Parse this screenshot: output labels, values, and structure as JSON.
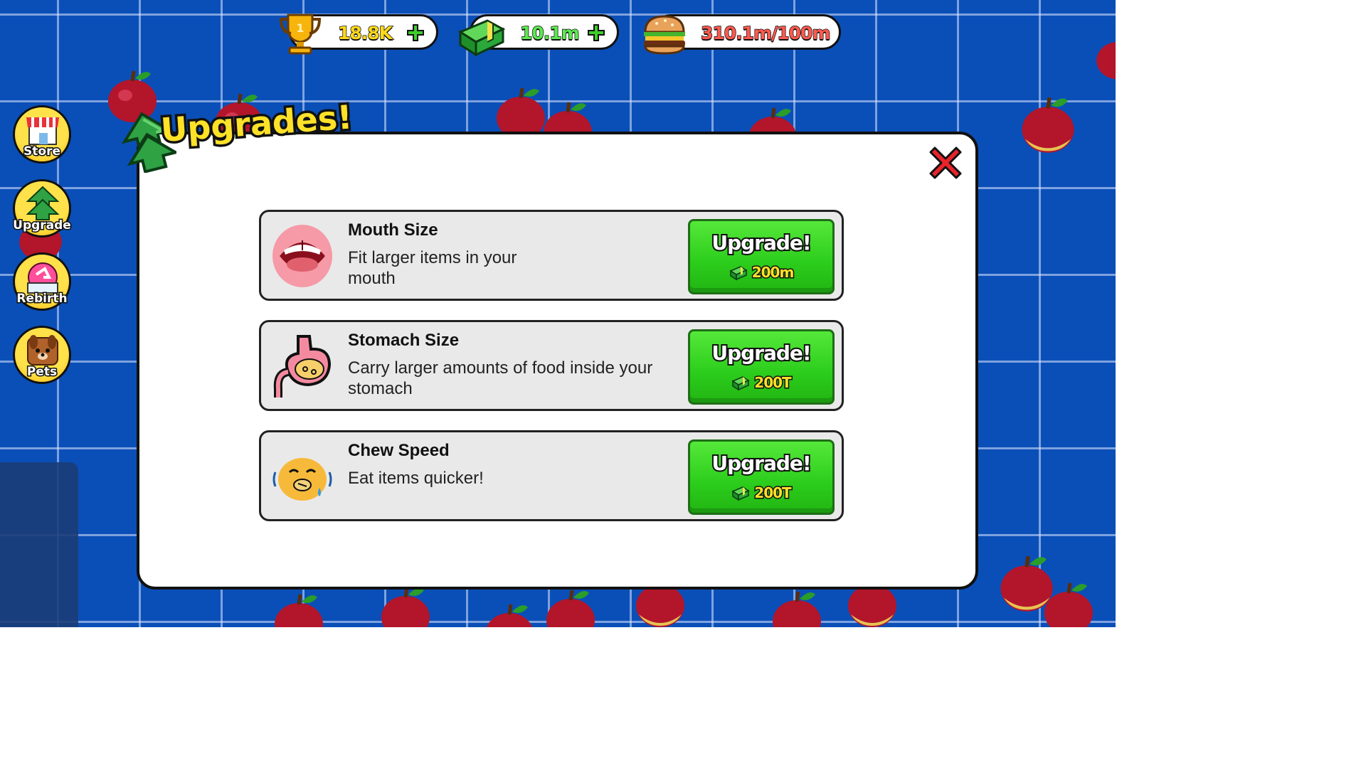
{
  "hud": {
    "trophies": {
      "icon": "trophy-icon",
      "value": "18.8K"
    },
    "cash": {
      "icon": "cash-stack-icon",
      "value": "10.1m"
    },
    "capacity": {
      "icon": "burger-icon",
      "value": "310.1m/100m"
    }
  },
  "side_menu": [
    {
      "label": "Store",
      "icon": "shop-icon"
    },
    {
      "label": "Upgrade",
      "icon": "up-arrow-icon"
    },
    {
      "label": "Rebirth",
      "icon": "rebirth-icon"
    },
    {
      "label": "Pets",
      "icon": "dog-icon"
    }
  ],
  "modal": {
    "title": "Upgrades!",
    "upgrades": [
      {
        "title": "Mouth Size",
        "description": "Fit larger items in your mouth",
        "icon": "mouth-icon",
        "button_label": "Upgrade!",
        "cost": "200m"
      },
      {
        "title": "Stomach Size",
        "description": "Carry larger amounts of food inside your stomach",
        "icon": "stomach-icon",
        "button_label": "Upgrade!",
        "cost": "200T"
      },
      {
        "title": "Chew Speed",
        "description": "Eat items quicker!",
        "icon": "chewing-face-icon",
        "button_label": "Upgrade!",
        "cost": "200T"
      }
    ]
  },
  "colors": {
    "background": "#0a4fb8",
    "title_yellow": "#ffe128",
    "button_green": "#2bcc1b",
    "close_red": "#e8242b",
    "capacity_red": "#ff5a4f"
  }
}
